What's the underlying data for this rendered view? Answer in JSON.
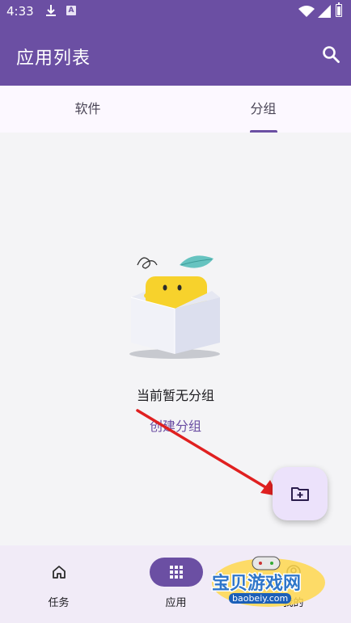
{
  "status_bar": {
    "time": "4:33",
    "notification_badge": "A"
  },
  "app_bar": {
    "title": "应用列表",
    "search_icon": "search-icon"
  },
  "tabs": [
    {
      "label": "软件",
      "selected": false
    },
    {
      "label": "分组",
      "selected": true
    }
  ],
  "empty_state": {
    "message": "当前暂无分组",
    "action_label": "创建分组",
    "illustration": "empty-box-illustration"
  },
  "fab": {
    "icon": "folder-add-icon"
  },
  "bottom_nav": {
    "items": [
      {
        "label": "任务",
        "icon": "home-icon",
        "selected": false
      },
      {
        "label": "应用",
        "icon": "grid-icon",
        "selected": true
      },
      {
        "label": "我的",
        "icon": "person-icon",
        "selected": false
      }
    ]
  },
  "watermark": {
    "text": "宝贝游戏网",
    "url": "baobeiy.com"
  },
  "colors": {
    "primary": "#6b4fa3",
    "fab_bg": "#ece2fb",
    "arrow": "#e02020",
    "watermark_blue": "#2f76c9"
  }
}
